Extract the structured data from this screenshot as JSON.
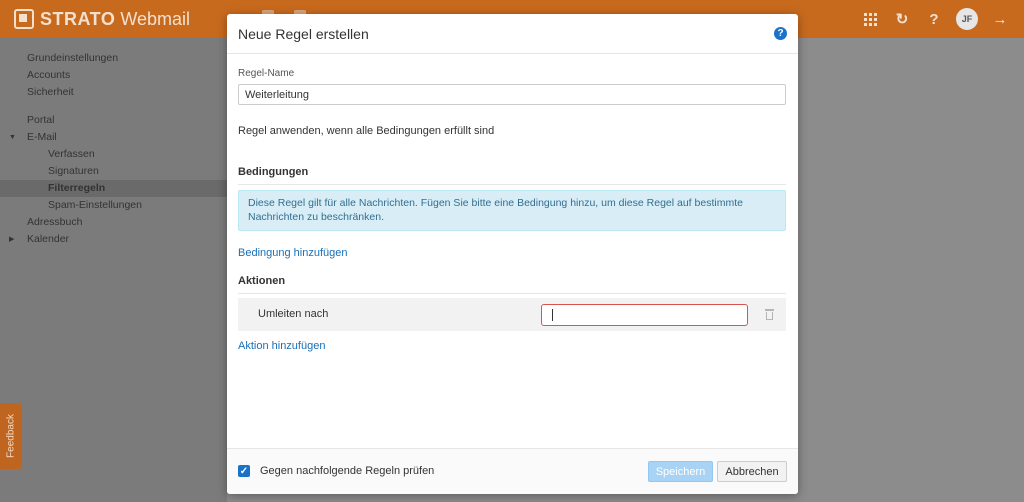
{
  "app": {
    "brand_strong": "STRATO",
    "brand_light": "Webmail",
    "user_initials": "JF"
  },
  "sidebar": {
    "group1": [
      "Grundeinstellungen",
      "Accounts",
      "Sicherheit"
    ],
    "portal": "Portal",
    "email": "E-Mail",
    "email_sub": [
      "Verfassen",
      "Signaturen",
      "Filterregeln",
      "Spam-Einstellungen"
    ],
    "adressbuch": "Adressbuch",
    "kalender": "Kalender",
    "feedback": "Feedback"
  },
  "modal": {
    "title": "Neue Regel erstellen",
    "name_label": "Regel-Name",
    "name_value": "Weiterleitung",
    "apply_note": "Regel anwenden, wenn alle Bedingungen erfüllt sind",
    "conditions_title": "Bedingungen",
    "info_text": "Diese Regel gilt für alle Nachrichten. Fügen Sie bitte eine Bedingung hinzu, um diese Regel auf bestimmte Nachrichten zu beschränken.",
    "add_condition": "Bedingung hinzufügen",
    "actions_title": "Aktionen",
    "action_label": "Umleiten nach",
    "action_value": "",
    "add_action": "Aktion hinzufügen",
    "check_label": "Gegen nachfolgende Regeln prüfen",
    "check_checked": true,
    "save_label": "Speichern",
    "cancel_label": "Abbrechen"
  },
  "colors": {
    "topbar": "#c86a1e",
    "primary": "#1a73c8",
    "link": "#1a6fb5",
    "info_bg": "#d9edf7",
    "error_border": "#d9534f"
  }
}
